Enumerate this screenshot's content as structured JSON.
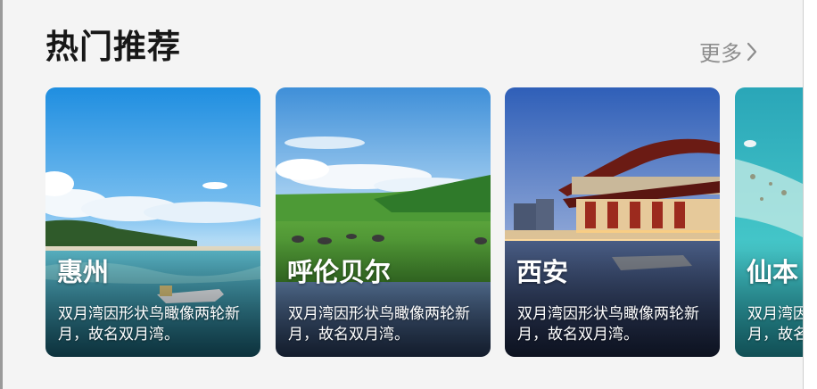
{
  "section": {
    "title": "热门推荐",
    "more_label": "更多"
  },
  "cards": [
    {
      "title": "惠州",
      "desc": "双月湾因形状鸟瞰像两轮新月，故名双月湾。"
    },
    {
      "title": "呼伦贝尔",
      "desc": "双月湾因形状鸟瞰像两轮新月，故名双月湾。"
    },
    {
      "title": "西安",
      "desc": "双月湾因形状鸟瞰像两轮新月，故名双月湾。"
    },
    {
      "title": "仙本",
      "desc": "双月湾因形状鸟瞰像两轮新月，故名双月湾。"
    }
  ],
  "colors": {
    "background": "#f4f4f4",
    "title": "#171717",
    "more": "#8d8d8d"
  }
}
